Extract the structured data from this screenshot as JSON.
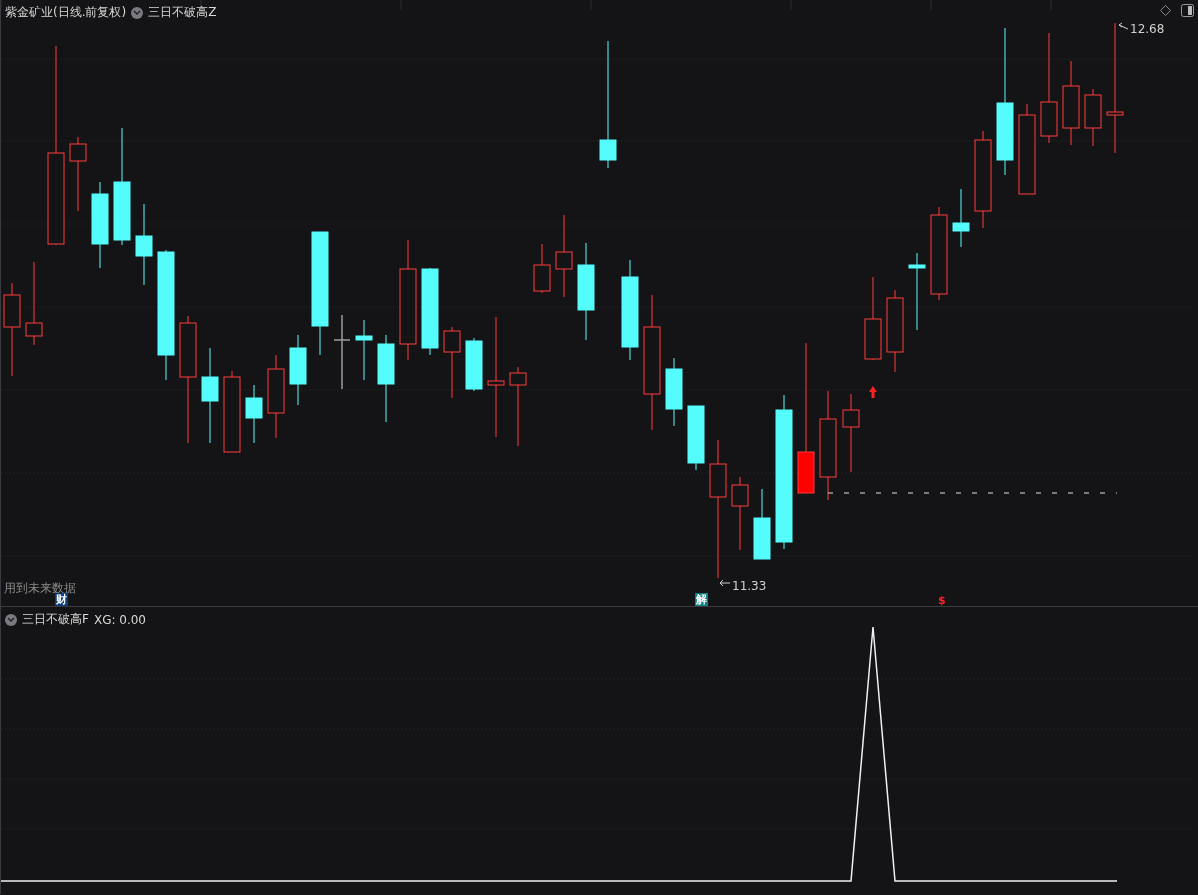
{
  "main_pane": {
    "title": "紫金矿业(日线.前复权)",
    "indicator": "三日不破高Z",
    "high_label": "12.68",
    "low_label": "11.33",
    "note": "用到未来数据",
    "event_markers": [
      {
        "label": "财",
        "kind": "finance"
      },
      {
        "label": "解",
        "kind": "unlock"
      },
      {
        "label": "$",
        "kind": "signal"
      }
    ]
  },
  "sub_pane": {
    "indicator": "三日不破高F",
    "reading": "XG: 0.00"
  }
}
